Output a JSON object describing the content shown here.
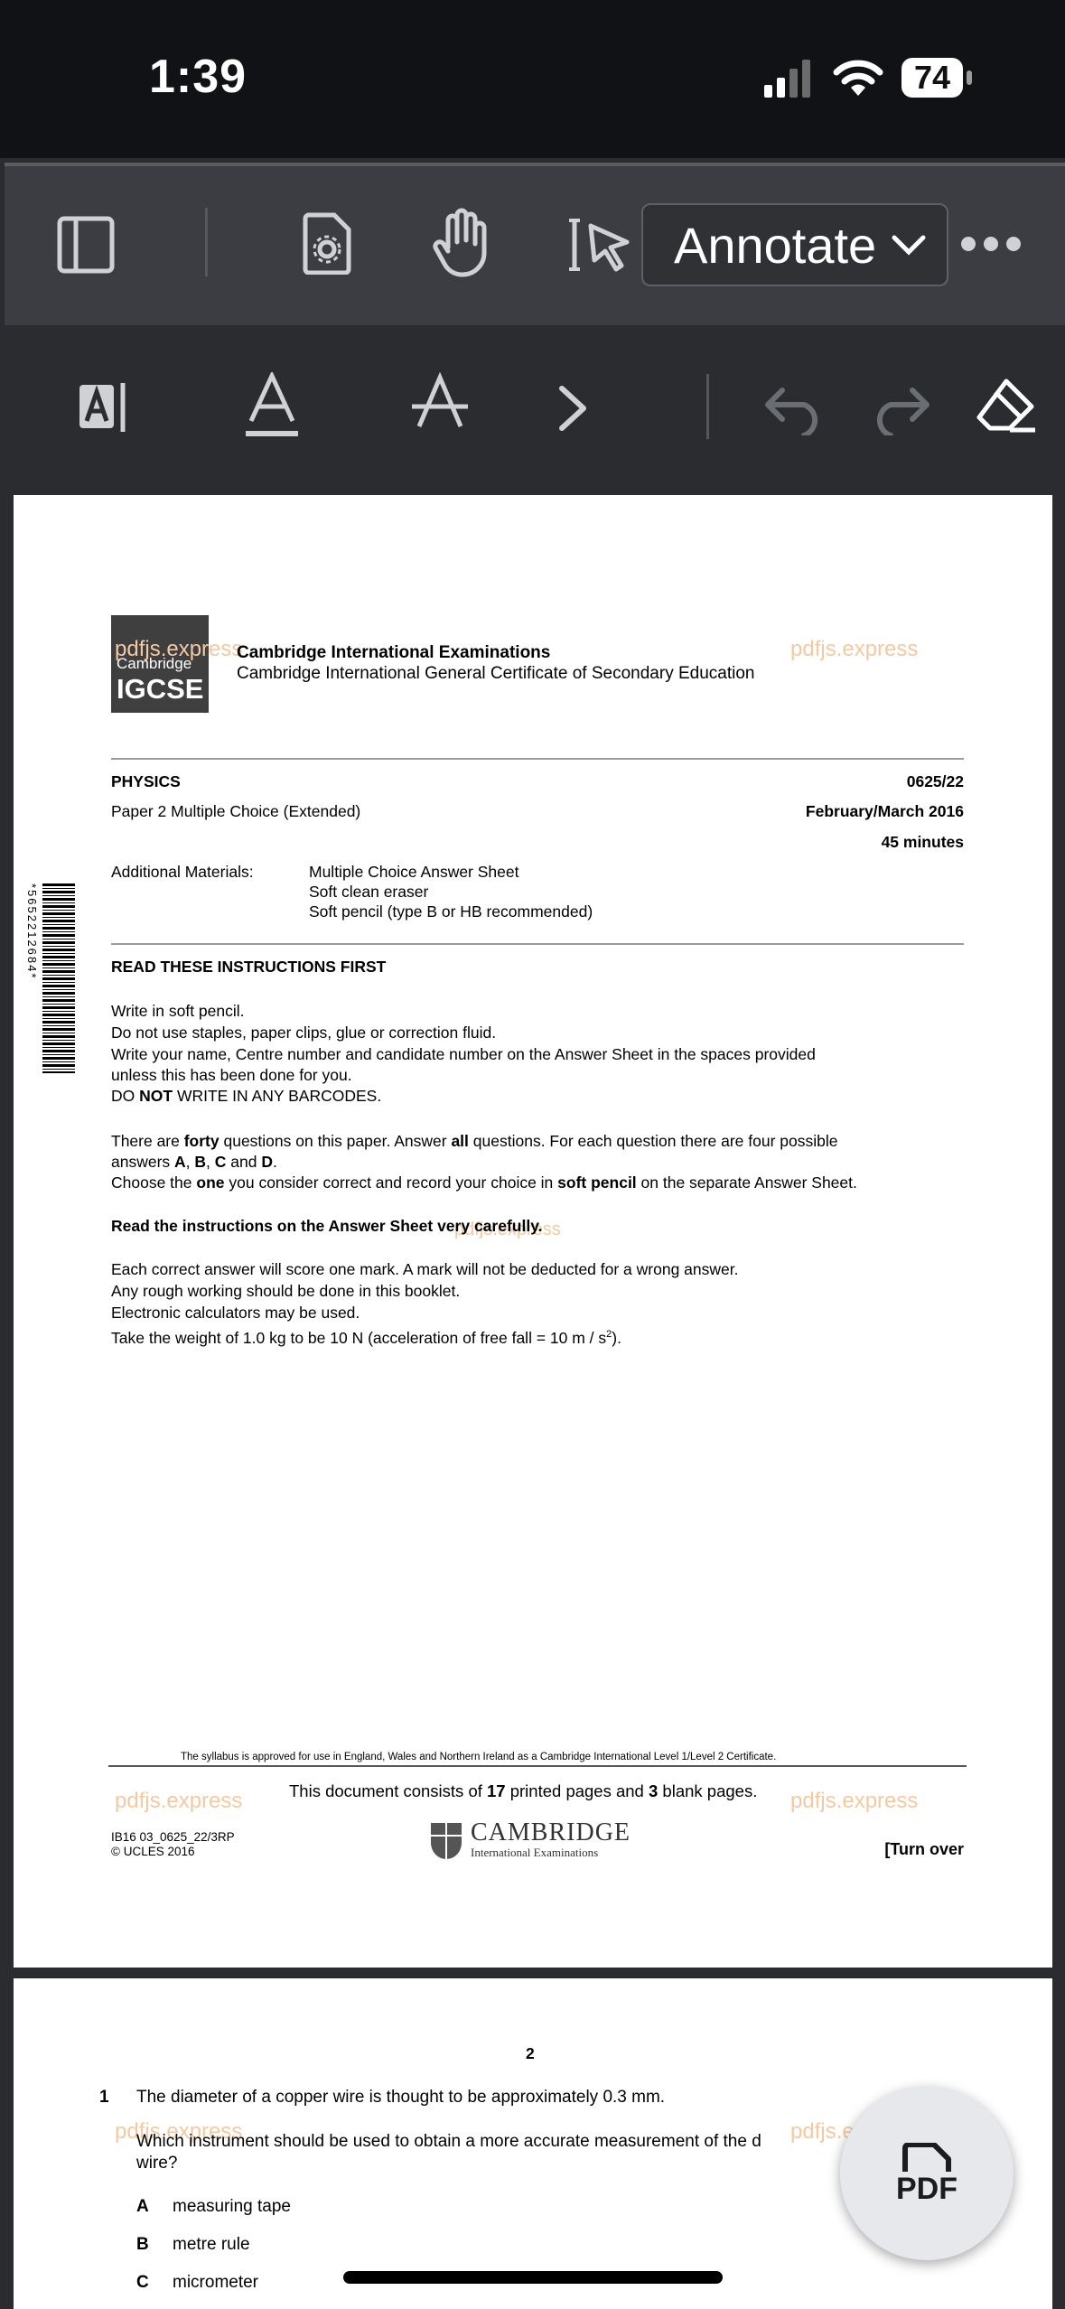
{
  "status_bar": {
    "time": "1:39",
    "battery": "74"
  },
  "toolbar": {
    "mode_label": "Annotate"
  },
  "icons": [
    "sidebar-toggle-icon",
    "page-settings-icon",
    "pan-hand-icon",
    "text-select-icon",
    "more-icon",
    "free-text-icon",
    "underline-icon",
    "strikeout-icon",
    "next-icon",
    "undo-icon",
    "redo-icon",
    "eraser-icon",
    "pdf-icon"
  ],
  "watermark": "pdfjs.express",
  "page1": {
    "logo_top": "Cambridge",
    "logo_bottom": "IGCSE",
    "exam_board": "Cambridge International Examinations",
    "certificate": "Cambridge International General Certificate of Secondary Education",
    "subject": "PHYSICS",
    "code": "0625/22",
    "paper": "Paper 2  Multiple Choice (Extended)",
    "session": "February/March 2016",
    "duration": "45 minutes",
    "materials_label": "Additional Materials:",
    "materials": [
      "Multiple Choice Answer Sheet",
      "Soft clean eraser",
      "Soft pencil (type B or HB recommended)"
    ],
    "barcode_number": "*5652212684*",
    "instructions_heading": "READ THESE INSTRUCTIONS FIRST",
    "instr_1": "Write in soft pencil.",
    "instr_2": "Do not use staples, paper clips, glue or correction fluid.",
    "instr_3": "Write your name, Centre number and candidate number on the Answer Sheet in the spaces provided",
    "instr_4": "unless this has been done for you.",
    "instr_5a": "DO ",
    "instr_5b": "NOT",
    "instr_5c": " WRITE IN ANY BARCODES.",
    "q_1a": "There are ",
    "q_1b": "forty",
    "q_1c": " questions on this paper. Answer ",
    "q_1d": "all",
    "q_1e": " questions. For each question there are four possible",
    "q_2a": "answers ",
    "q_2b": "A",
    "q_2c": ", ",
    "q_2d": "B",
    "q_2e": ", ",
    "q_2f": "C",
    "q_2g": " and ",
    "q_2h": "D",
    "q_2i": ".",
    "q_3a": "Choose the ",
    "q_3b": "one",
    "q_3c": " you consider correct and record your choice in ",
    "q_3d": "soft pencil",
    "q_3e": " on the separate Answer Sheet.",
    "read_carefully": "Read the instructions on the Answer Sheet very carefully.",
    "mark_1": "Each correct answer will score one mark. A mark will not be deducted for a wrong answer.",
    "mark_2": "Any rough working should be done in this booklet.",
    "mark_3": "Electronic calculators may be used.",
    "mark_4a": "Take the weight of 1.0 kg to be 10 N (acceleration of free fall = 10 m / s",
    "mark_4b": "2",
    "mark_4c": ").",
    "syllabus_note": "The syllabus is approved for use in England, Wales and Northern Ireland as a Cambridge International Level 1/Level 2 Certificate.",
    "consists_a": "This document consists of ",
    "consists_b": "17",
    "consists_c": " printed pages and ",
    "consists_d": "3",
    "consists_e": " blank pages.",
    "ref_code": "IB16 03_0625_22/3RP",
    "copyright": "© UCLES 2016",
    "cambridge_word": "CAMBRIDGE",
    "cambridge_sub": "International Examinations",
    "turn_over": "[Turn over"
  },
  "page2": {
    "page_number": "2",
    "q_number": "1",
    "q_text": "The diameter of a copper wire is thought to be approximately 0.3 mm.",
    "q_prompt_1": "Which instrument should be used to obtain a more accurate measurement of the d",
    "q_prompt_2": "wire?",
    "options": [
      {
        "letter": "A",
        "text": "measuring tape"
      },
      {
        "letter": "B",
        "text": "metre rule"
      },
      {
        "letter": "C",
        "text": "micrometer"
      }
    ]
  },
  "fab": {
    "label": "PDF"
  }
}
